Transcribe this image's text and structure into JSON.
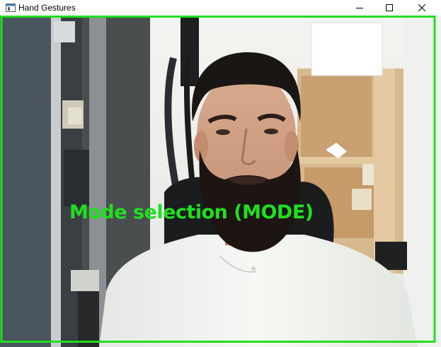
{
  "window": {
    "title": "Hand Gestures",
    "icons": {
      "app": "app-window-icon",
      "minimize": "minimize-icon",
      "maximize": "maximize-icon",
      "close": "close-icon"
    }
  },
  "video": {
    "overlay_text": "Mode selection (MODE)",
    "overlay_color": "#1fe01f",
    "border_color": "#1fe01f"
  }
}
